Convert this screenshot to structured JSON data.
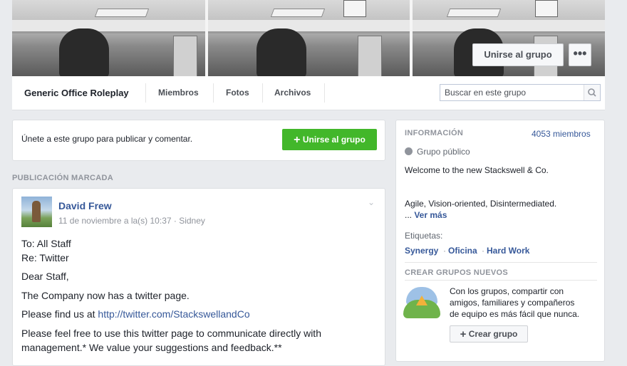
{
  "cover": {
    "join_button": "Unirse al grupo",
    "more_button": "•••"
  },
  "nav": {
    "group_name": "Generic Office Roleplay",
    "tabs": [
      {
        "label": "Miembros"
      },
      {
        "label": "Fotos"
      },
      {
        "label": "Archivos"
      }
    ],
    "search_placeholder": "Buscar en este grupo",
    "search_icon": "magnifier-icon"
  },
  "join_box": {
    "prompt": "Únete a este grupo para publicar y comentar.",
    "button_label": "Unirse al grupo",
    "button_icon": "plus-icon"
  },
  "pinned": {
    "section_label": "PUBLICACIÓN MARCADA",
    "author": "David Frew",
    "meta": "11 de noviembre a la(s) 10:37 · Sidney",
    "lines": {
      "to": "To: All Staff",
      "re": "Re: Twitter",
      "greeting": "Dear Staff,",
      "p1": "The Company now has a twitter page.",
      "p2_prefix": "Please find us at ",
      "p2_link": "http://twitter.com/StackswellandCo",
      "p3a": "Please feel free to use this twitter page to communicate directly with",
      "p3b": "management.* We value your suggestions and feedback.**"
    }
  },
  "info": {
    "title": "INFORMACIÓN",
    "members": "4053 miembros",
    "privacy": "Grupo público",
    "desc1": "Welcome to the new Stackswell & Co.",
    "desc2": "Agile, Vision-oriented, Disintermediated.",
    "see_more_prefix": "... ",
    "see_more": "Ver más",
    "tags_label": "Etiquetas:",
    "tags": [
      "Synergy",
      "Oficina",
      "Hard Work"
    ],
    "tag_sep": "·"
  },
  "create_groups": {
    "title": "CREAR GRUPOS NUEVOS",
    "text1": "Con los grupos, compartir con",
    "text2": "amigos, familiares y compañeros",
    "text3": "de equipo es más fácil que nunca.",
    "button_label": "Crear grupo",
    "button_icon": "plus-icon"
  },
  "colors": {
    "link": "#365899",
    "join_green": "#42b72a",
    "page_bg": "#e9ebee"
  }
}
